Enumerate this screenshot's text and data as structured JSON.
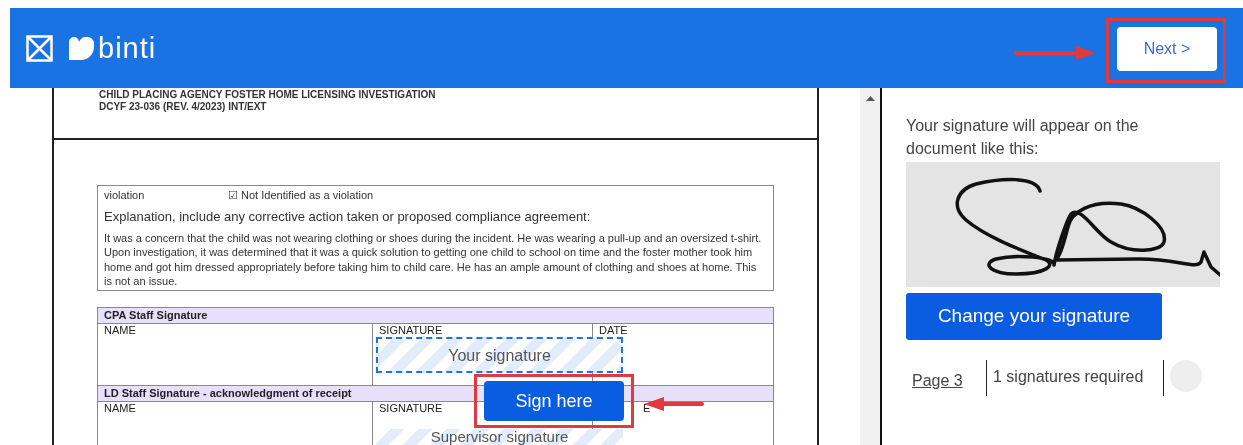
{
  "header": {
    "logo_text": "binti",
    "next_button": "Next >"
  },
  "document": {
    "title_lines": [
      "CHILD PLACING AGENCY FOSTER HOME LICENSING INVESTIGATION",
      "DCYF 23-036 (REV. 4/2023) INT/EXT"
    ],
    "finding": {
      "label": "violation",
      "option": "☑ Not Identified as a violation"
    },
    "explanation_label": "Explanation, include any corrective action taken or proposed compliance agreement:",
    "explanation": "It was a concern that the child was not wearing clothing or shoes during the incident. He was wearing a pull-up and an oversized t-shirt. Upon investigation, it was determined that it was a quick solution to getting one child to school on time and the foster mother took him home and got him dressed appropriately before taking him to child care. He has an ample amount of clothing and shoes at home. This is not an issue.",
    "signature_sections": [
      {
        "title": "CPA Staff Signature",
        "columns": [
          "NAME",
          "SIGNATURE",
          "DATE"
        ],
        "signature_box": "Your signature"
      },
      {
        "title": "LD Staff Signature - acknowledgment of receipt",
        "columns": [
          "NAME",
          "SIGNATURE",
          "E"
        ],
        "signature_box": "Supervisor signature"
      }
    ],
    "sign_here_button": "Sign here"
  },
  "signature_panel": {
    "intro": "Your signature will appear on the document like this:",
    "change_button": "Change your signature",
    "page_link": "Page 3",
    "required": "1 signatures required"
  }
}
